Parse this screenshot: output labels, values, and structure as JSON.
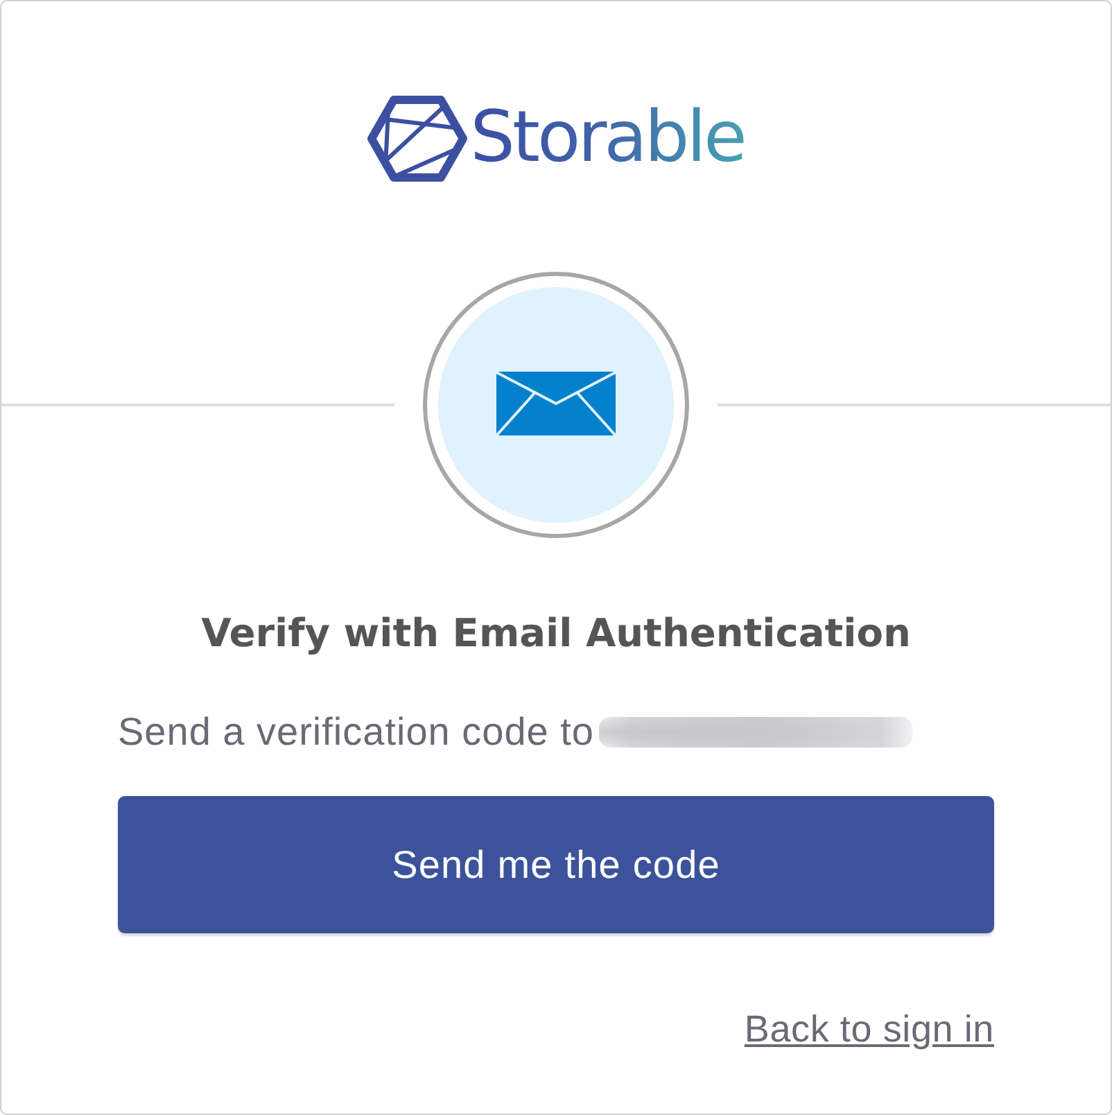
{
  "logo": {
    "wordmark": "Storable"
  },
  "title": "Verify with Email Authentication",
  "instruction": {
    "text": "Send a verification code to",
    "recipient_redacted": true
  },
  "primary_button": {
    "label": "Send me the code"
  },
  "back_link": {
    "label": "Back to sign in"
  }
}
